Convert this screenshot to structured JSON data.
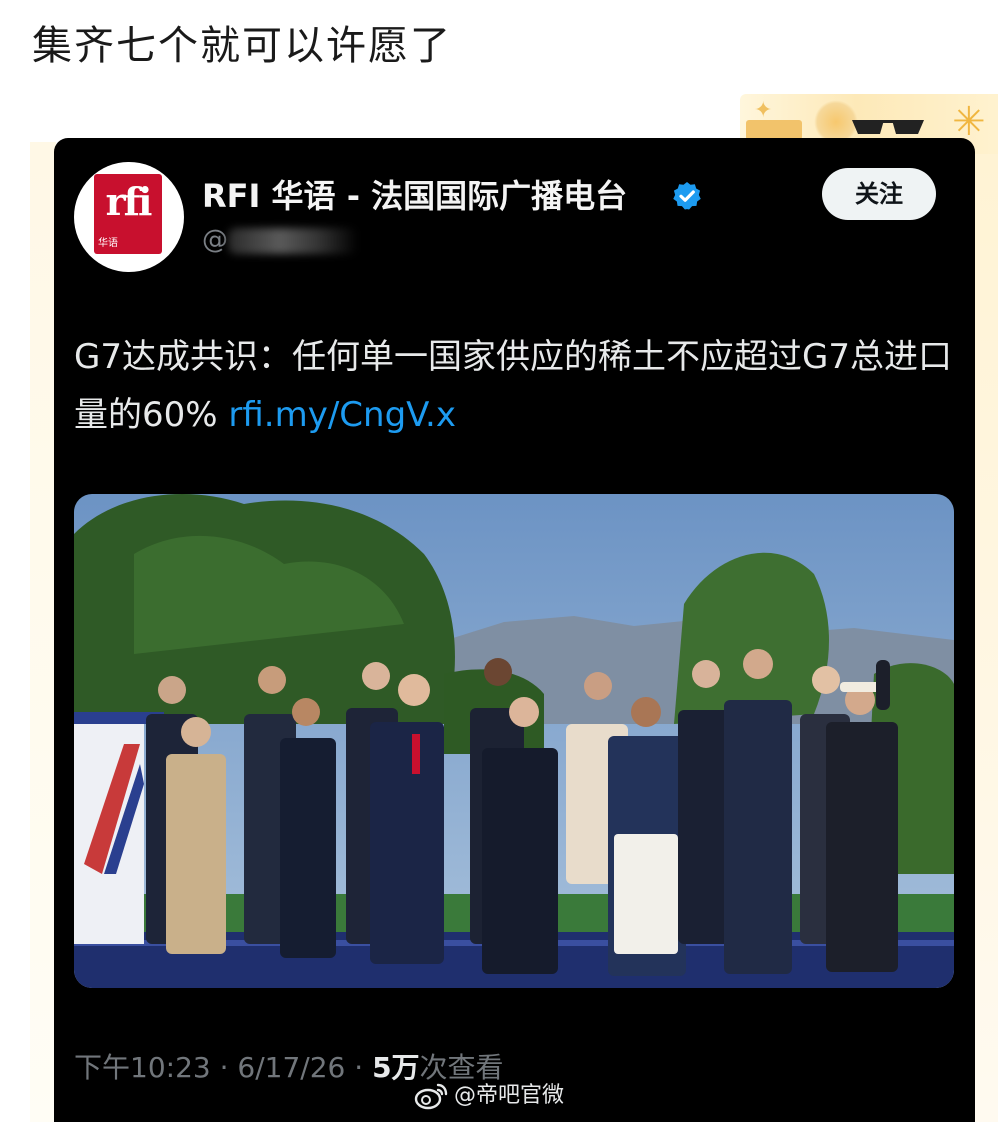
{
  "post": {
    "title": "集齐七个就可以许愿了"
  },
  "tweet": {
    "avatar_logo": "rfi",
    "avatar_sub": "华语",
    "account_name": "RFI 华语 - 法国国际广播电台",
    "handle": "@",
    "follow_label": "关注",
    "text": "G7达成共识：任何单一国家供应的稀土不应超过G7总进口量的60% ",
    "link": "rfi.my/CngV.x",
    "time": "下午10:23",
    "date": "6/17/26",
    "views_count": "5万",
    "views_label": "次查看",
    "separator": " · "
  },
  "watermark": {
    "text": "@帝吧官微"
  },
  "icons": {
    "verified": "verified-badge-icon",
    "weibo": "weibo-icon"
  },
  "colors": {
    "card_bg": "#000000",
    "link": "#1d9bf0",
    "verified": "#1d9bf0",
    "rfi_red": "#c8102e"
  }
}
